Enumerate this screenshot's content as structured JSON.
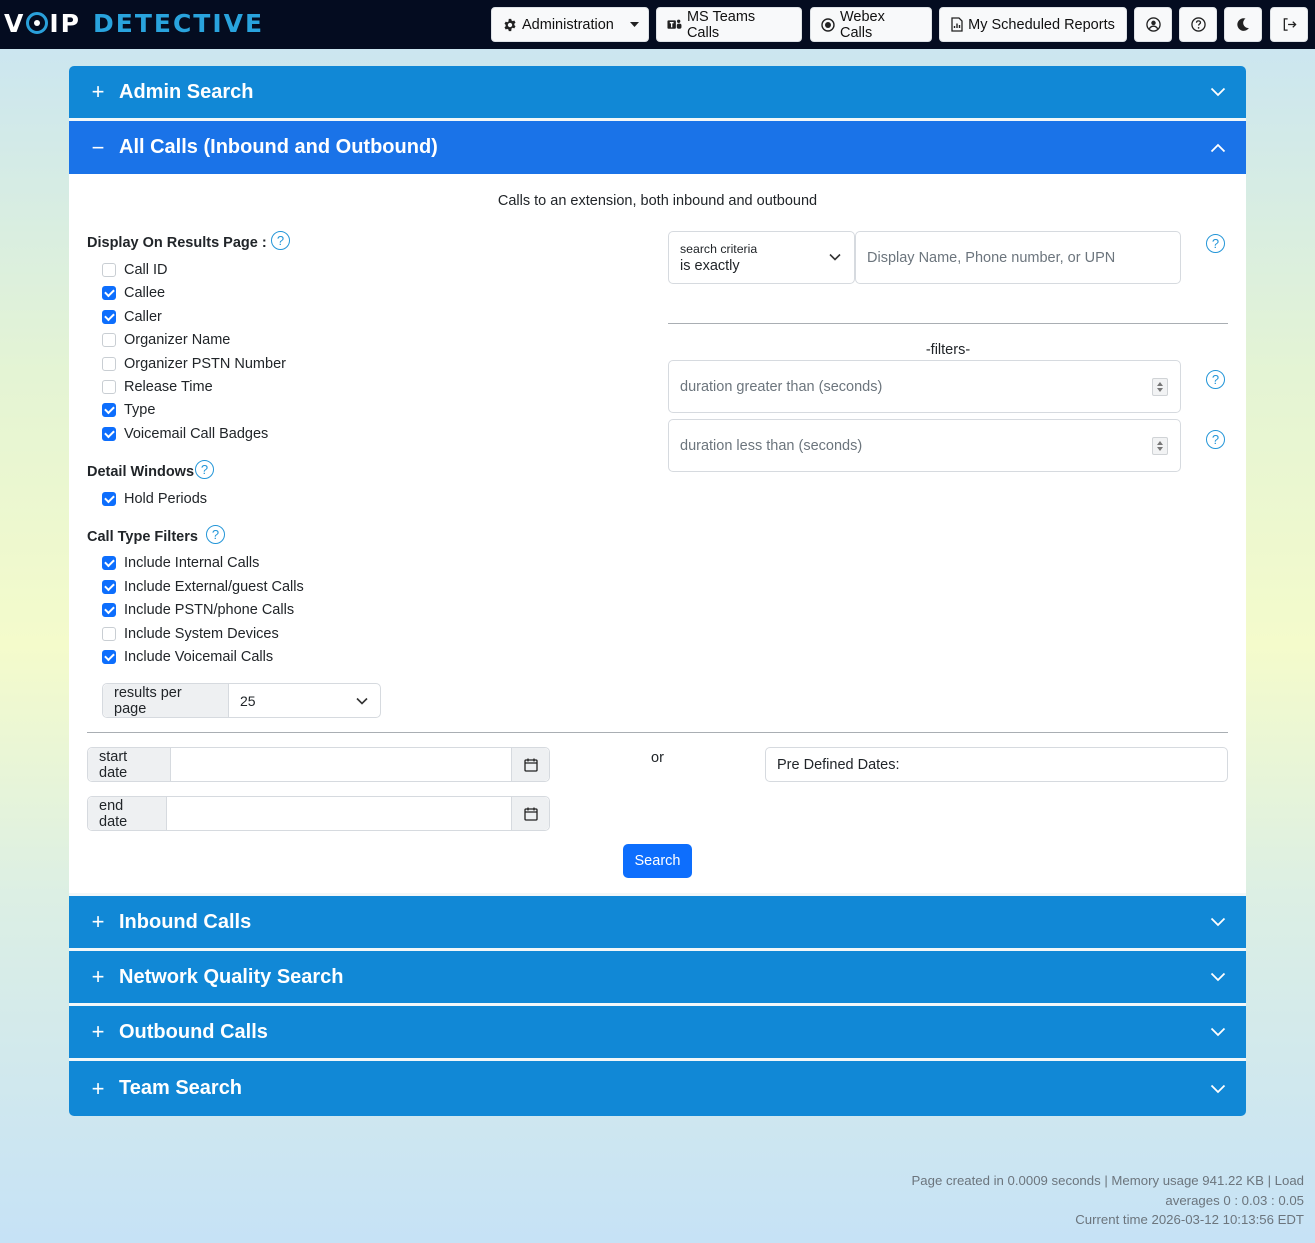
{
  "brand": {
    "part1": "V",
    "part2": "IP",
    "part3": "DETECTIVE"
  },
  "nav": {
    "administration": "Administration",
    "ms_teams_calls": "MS Teams Calls",
    "webex_calls": "Webex Calls",
    "scheduled_reports": "My Scheduled Reports"
  },
  "sections": {
    "admin_search": "Admin Search",
    "all_calls": "All Calls (Inbound and Outbound)",
    "inbound_calls": "Inbound Calls",
    "network_quality": "Network Quality Search",
    "outbound_calls": "Outbound Calls",
    "team_search": "Team Search"
  },
  "all_calls": {
    "description": "Calls to an extension, both inbound and outbound",
    "display_label": "Display On Results Page :",
    "display_options": [
      {
        "label": "Call ID",
        "checked": false
      },
      {
        "label": "Callee",
        "checked": true
      },
      {
        "label": "Caller",
        "checked": true
      },
      {
        "label": "Organizer Name",
        "checked": false
      },
      {
        "label": "Organizer PSTN Number",
        "checked": false
      },
      {
        "label": "Release Time",
        "checked": false
      },
      {
        "label": "Type",
        "checked": true
      },
      {
        "label": "Voicemail Call Badges",
        "checked": true
      }
    ],
    "detail_label": "Detail Windows",
    "detail_options": [
      {
        "label": "Hold Periods",
        "checked": true
      }
    ],
    "call_type_label": "Call Type Filters",
    "call_type_options": [
      {
        "label": "Include Internal Calls",
        "checked": true
      },
      {
        "label": "Include External/guest Calls",
        "checked": true
      },
      {
        "label": "Include PSTN/phone Calls",
        "checked": true
      },
      {
        "label": "Include System Devices",
        "checked": false
      },
      {
        "label": "Include Voicemail Calls",
        "checked": true
      }
    ],
    "results_per_page_label": "results per page",
    "results_per_page_value": "25",
    "search_criteria_label": "search criteria",
    "search_criteria_value": "is exactly",
    "search_placeholder": "Display Name, Phone number, or UPN",
    "filters_label": "-filters-",
    "duration_gt_placeholder": "duration greater than (seconds)",
    "duration_lt_placeholder": "duration less than (seconds)",
    "start_date_label": "start date",
    "end_date_label": "end date",
    "or_label": "or",
    "predefined_dates_label": "Pre Defined Dates:",
    "search_button": "Search",
    "help_glyph": "?"
  },
  "footer": {
    "line1": "Page created in 0.0009 seconds | Memory usage 941.22 KB | Load",
    "line2": "averages 0 : 0.03 : 0.05",
    "line3": "Current time 2026-03-12 10:13:56 EDT"
  },
  "colors": {
    "navbar": "#040c20",
    "accordion_header": "#1188d6",
    "accordion_open": "#1a73e8",
    "primary": "#0d6efd",
    "help": "#2496d8"
  },
  "icons": {
    "administration": "gear-icon",
    "ms_teams": "teams-icon",
    "webex": "record-icon",
    "reports": "report-icon",
    "user": "user-circle-icon",
    "help": "question-circle-icon",
    "theme": "moon-icon",
    "logout": "logout-icon"
  }
}
